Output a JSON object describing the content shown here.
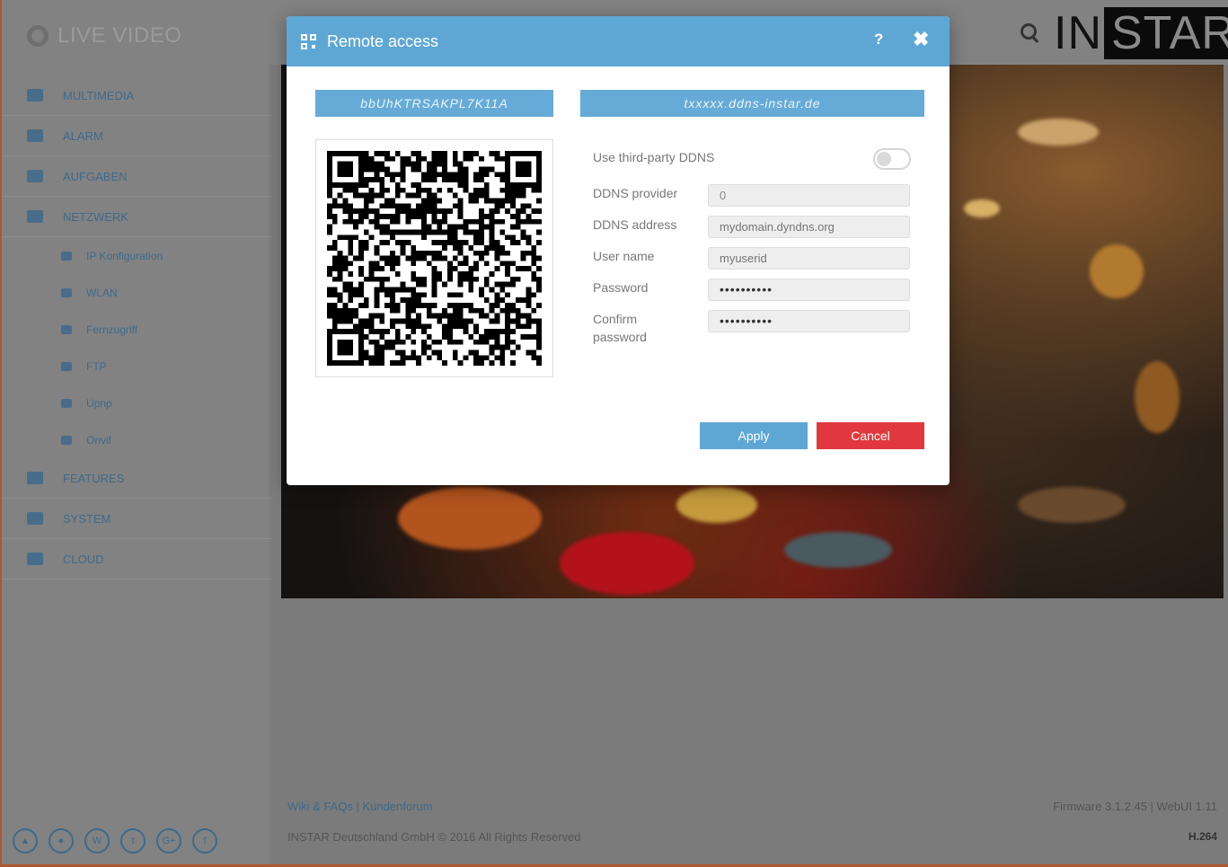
{
  "app": {
    "title": "LIVE VIDEO",
    "brand_left": "IN",
    "brand_right": "STAR"
  },
  "sidebar": {
    "items": [
      {
        "label": "MULTIMEDIA",
        "icon": "image-icon"
      },
      {
        "label": "ALARM",
        "icon": "bell-icon"
      },
      {
        "label": "AUFGABEN",
        "icon": "film-icon"
      },
      {
        "label": "NETZWERK",
        "icon": "network-icon"
      }
    ],
    "subitems": [
      {
        "label": "IP Konfiguration",
        "icon": "globe-icon"
      },
      {
        "label": "WLAN",
        "icon": "wifi-icon"
      },
      {
        "label": "Fernzugriff",
        "icon": "qr-icon"
      },
      {
        "label": "FTP",
        "icon": "user-icon"
      },
      {
        "label": "Upnp",
        "icon": "link-icon"
      },
      {
        "label": "Onvif",
        "icon": "circle-icon"
      }
    ],
    "items_bottom": [
      {
        "label": "FEATURES",
        "icon": "star-icon"
      },
      {
        "label": "SYSTEM",
        "icon": "gear-icon"
      },
      {
        "label": "CLOUD",
        "icon": "cloud-icon"
      }
    ],
    "social": [
      "▲",
      "●",
      "W",
      "t",
      "G+",
      "f"
    ]
  },
  "footer": {
    "links": "Wiki & FAQs | Kundenforum",
    "copyright": "INSTAR Deutschland GmbH © 2016 All Rights Reserved",
    "firmware": "Firmware 3.1.2.45 | WebUI 1.11",
    "codec": "H.264"
  },
  "modal": {
    "title": "Remote access",
    "help_label": "?",
    "close_label": "✖",
    "id_left": "bbUhKTRSAKPL7K11A",
    "id_right": "txxxxx.ddns-instar.de",
    "form": {
      "third_party_label": "Use third-party DDNS",
      "third_party_enabled": false,
      "provider_label": "DDNS provider",
      "provider_value": "0",
      "address_label": "DDNS address",
      "address_placeholder": "mydomain.dyndns.org",
      "user_label": "User name",
      "user_placeholder": "myuserid",
      "password_label": "Password",
      "password_value": "••••••••••",
      "confirm_label_1": "Confirm",
      "confirm_label_2": "password",
      "confirm_value": "••••••••••"
    },
    "apply_label": "Apply",
    "cancel_label": "Cancel"
  },
  "colors": {
    "accent": "#5ea7d5",
    "danger": "#e0383e",
    "overlay": "#7b7b7b"
  }
}
